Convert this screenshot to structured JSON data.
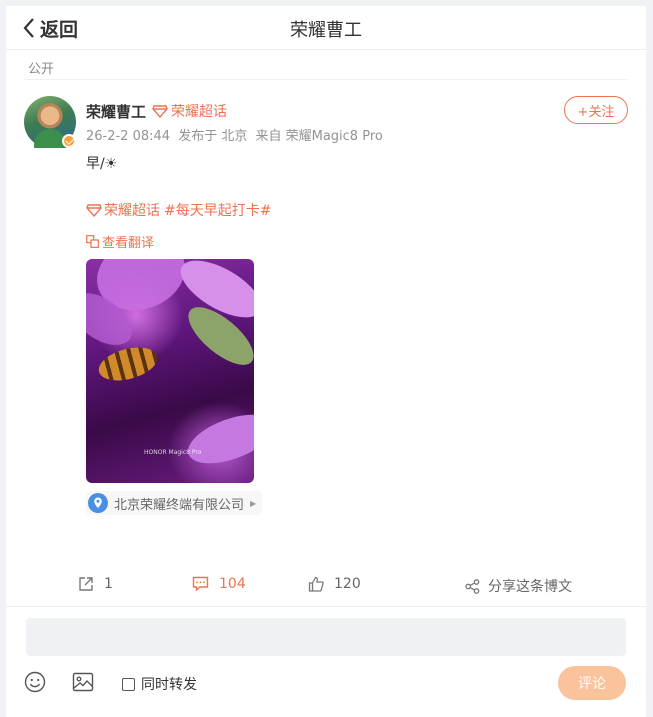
{
  "header": {
    "back_label": "返回",
    "title": "荣耀曹工"
  },
  "visibility": "公开",
  "post": {
    "username": "荣耀曹工",
    "supertopic": "荣耀超话",
    "follow_label": "+关注",
    "meta": {
      "time": "26-2-2 08:44",
      "location_text": "发布于 北京",
      "source": "来自 荣耀Magic8 Pro"
    },
    "text": "早/☀",
    "tags": [
      "荣耀超话",
      "#每天早起打卡#"
    ],
    "translate_label": "查看翻译",
    "photo_watermark": {
      "brand": "HONOR Magic8 Pro"
    },
    "location_tag": "北京荣耀终端有限公司"
  },
  "actions": {
    "repost_count": "1",
    "comment_count": "104",
    "like_count": "120",
    "share_label": "分享这条博文"
  },
  "composer": {
    "placeholder": "",
    "repost_label": "同时转发",
    "submit_label": "评论"
  },
  "colors": {
    "accent": "#eb7350",
    "submit_bg": "#fbc39c"
  }
}
